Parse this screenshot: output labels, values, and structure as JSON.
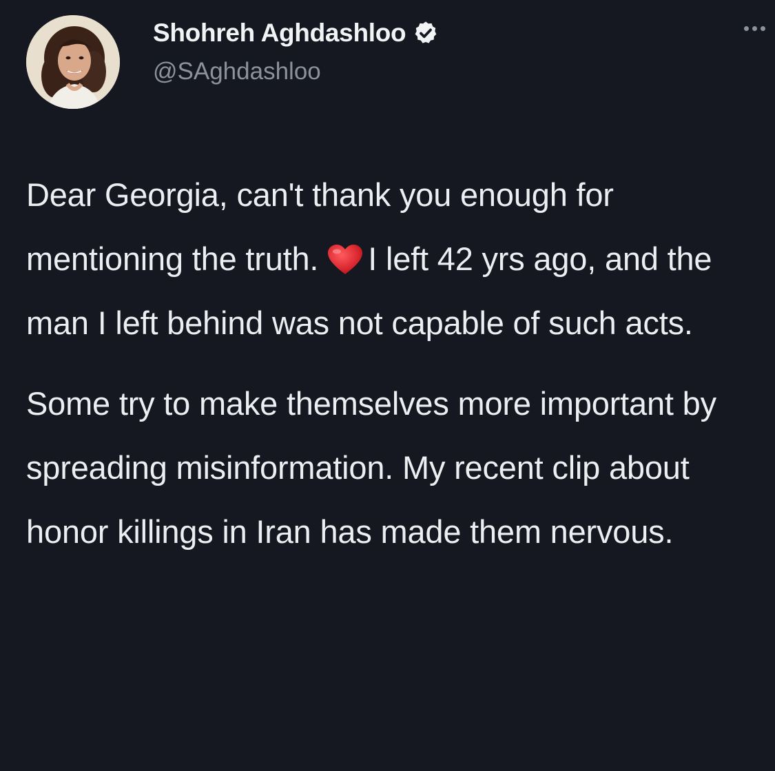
{
  "tweet": {
    "display_name": "Shohreh Aghdashloo",
    "handle": "@SAghdashloo",
    "verified": true,
    "verified_icon": "verified-badge-icon",
    "more_icon": "more-options-icon",
    "paragraph_1": {
      "before_emoji": "Dear Georgia, can't thank you enough for mentioning the truth.",
      "emoji": "heart-emoji",
      "after_emoji": "I left 42 yrs ago, and the man I left behind was not capable of such acts."
    },
    "paragraph_2": "Some try to make themselves more important by spreading misinformation. My recent clip about honor killings in Iran has made them nervous."
  },
  "colors": {
    "background": "#151820",
    "text": "#eceef1",
    "handle": "#8c929b",
    "heart": "#d9262e"
  }
}
